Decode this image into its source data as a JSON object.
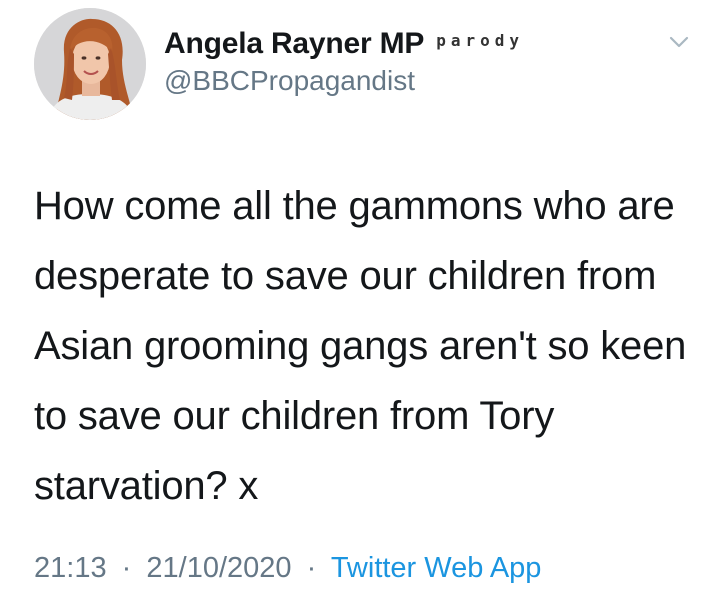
{
  "tweet": {
    "author": {
      "display_name": "Angela Rayner MP",
      "badge": "parody",
      "handle": "@BBCPropagandist"
    },
    "menu_icon": "chevron-down-icon",
    "text": "How come all the gammons who are desperate to save our children from Asian grooming gangs aren't so keen to save our children from Tory starvation? x",
    "time": "21:13",
    "date": "21/10/2020",
    "separator": "·",
    "source": "Twitter Web App"
  },
  "colors": {
    "primary_text": "#14171a",
    "secondary_text": "#657786",
    "link": "#1b95e0"
  }
}
